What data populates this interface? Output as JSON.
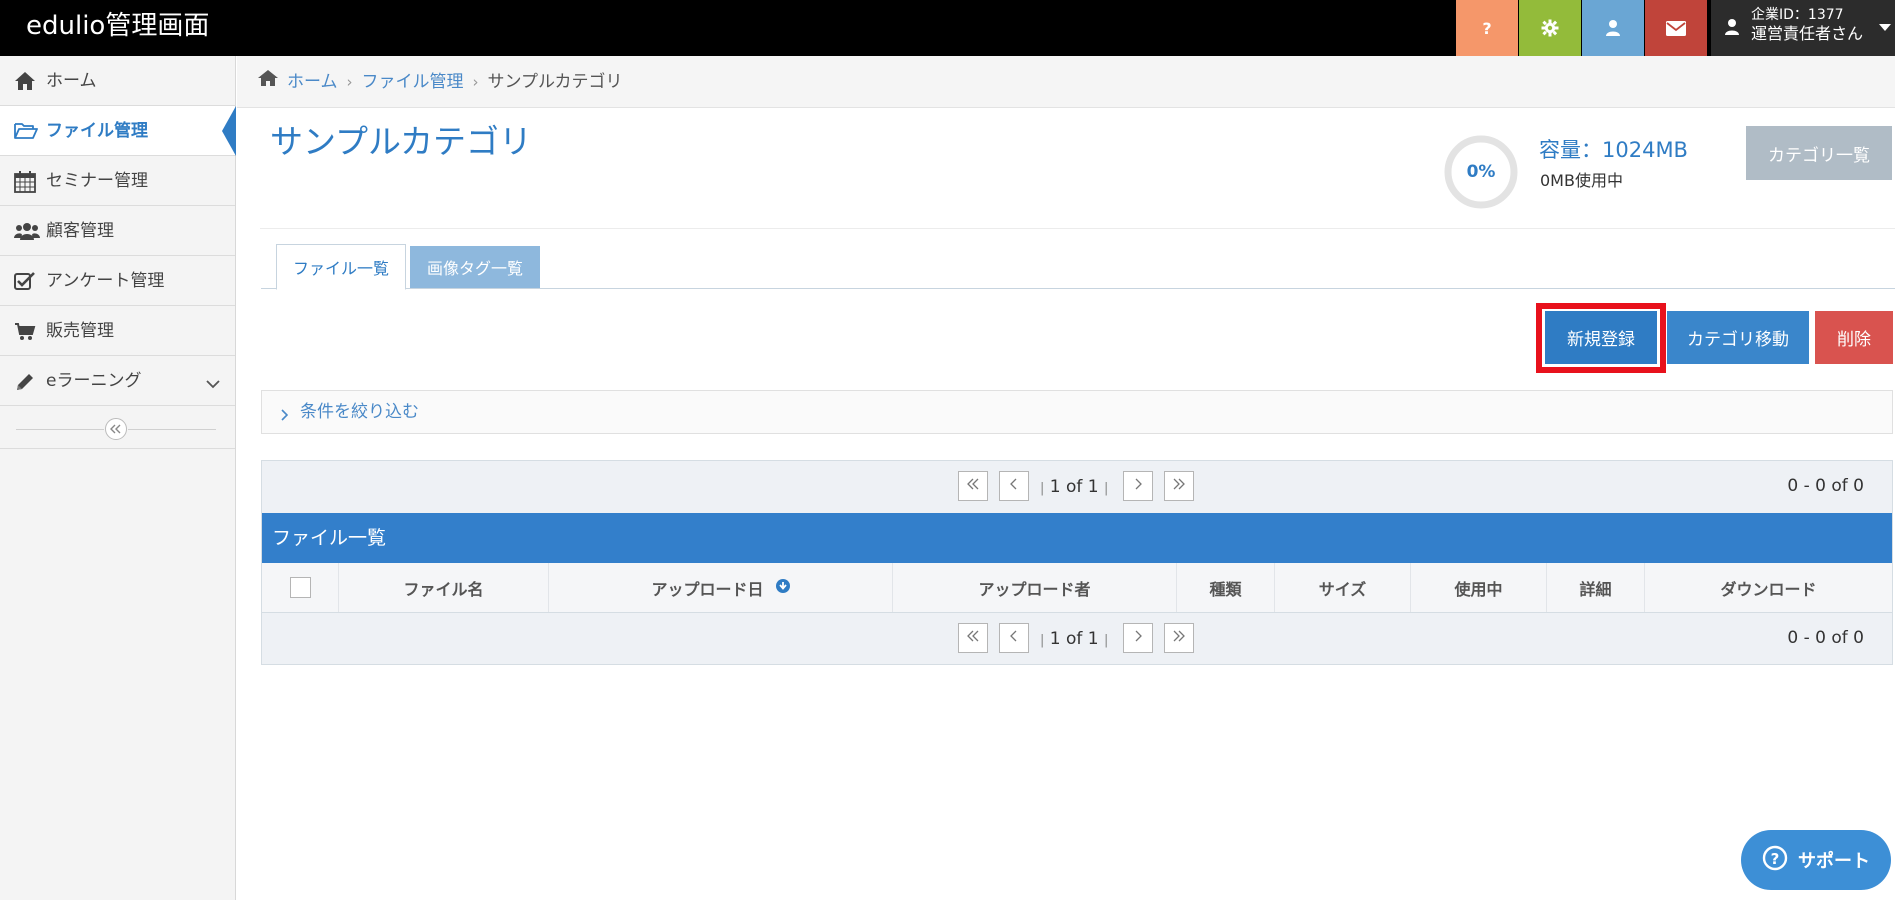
{
  "app": {
    "title": "edulio管理画面"
  },
  "account": {
    "company_id": "企業ID：1377",
    "user_name": "運営責任者さん"
  },
  "sidebar": {
    "items": [
      {
        "label": "ホーム",
        "icon": "home-icon"
      },
      {
        "label": "ファイル管理",
        "icon": "folder-open-icon",
        "active": true
      },
      {
        "label": "セミナー管理",
        "icon": "calendar-icon"
      },
      {
        "label": "顧客管理",
        "icon": "users-icon"
      },
      {
        "label": "アンケート管理",
        "icon": "checkbox-icon"
      },
      {
        "label": "販売管理",
        "icon": "cart-icon"
      },
      {
        "label": "eラーニング",
        "icon": "pencil-icon"
      }
    ]
  },
  "breadcrumb": {
    "home": "ホーム",
    "files": "ファイル管理",
    "current": "サンプルカテゴリ"
  },
  "page": {
    "title": "サンプルカテゴリ",
    "usage_percent": "0%",
    "capacity": "容量：1024MB",
    "used": "0MB使用中",
    "category_list_button": "カテゴリ一覧"
  },
  "tabs": [
    {
      "label": "ファイル一覧",
      "active": true
    },
    {
      "label": "画像タグ一覧",
      "active": false
    }
  ],
  "actions": {
    "new": "新規登録",
    "move": "カテゴリ移動",
    "delete": "削除"
  },
  "filter": {
    "label": "条件を絞り込む"
  },
  "pager": {
    "page_text": "1 of 1",
    "count_text": "0 - 0 of 0"
  },
  "file_list": {
    "title": "ファイル一覧",
    "columns": [
      "ファイル名",
      "アップロード日",
      "アップロード者",
      "種類",
      "サイズ",
      "使用中",
      "詳細",
      "ダウンロード"
    ]
  },
  "support": {
    "label": "サポート"
  },
  "colors": {
    "accent": "#2f7cc4",
    "highlight": "#e8111c",
    "danger": "#d9534f"
  }
}
